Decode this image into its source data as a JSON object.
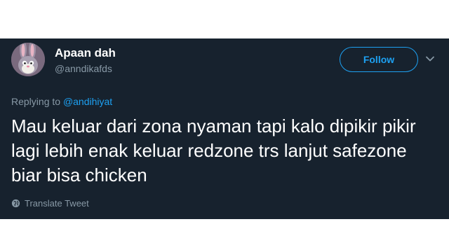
{
  "user": {
    "display_name": "Apaan dah",
    "handle": "@anndikafds"
  },
  "follow_label": "Follow",
  "reply": {
    "prefix": "Replying to",
    "mention": "@andihiyat"
  },
  "tweet_text": "Mau keluar dari zona nyaman tapi kalo dipikir pikir lagi lebih enak keluar redzone trs lanjut safezone biar bisa chicken",
  "translate_label": "Translate Tweet",
  "icons": [
    "avatar-image",
    "chevron-down-icon",
    "globe-icon"
  ],
  "colors": {
    "background": "#17222e",
    "accent": "#1da1f2",
    "secondary_text": "#8899a6",
    "primary_text": "#ffffff"
  }
}
